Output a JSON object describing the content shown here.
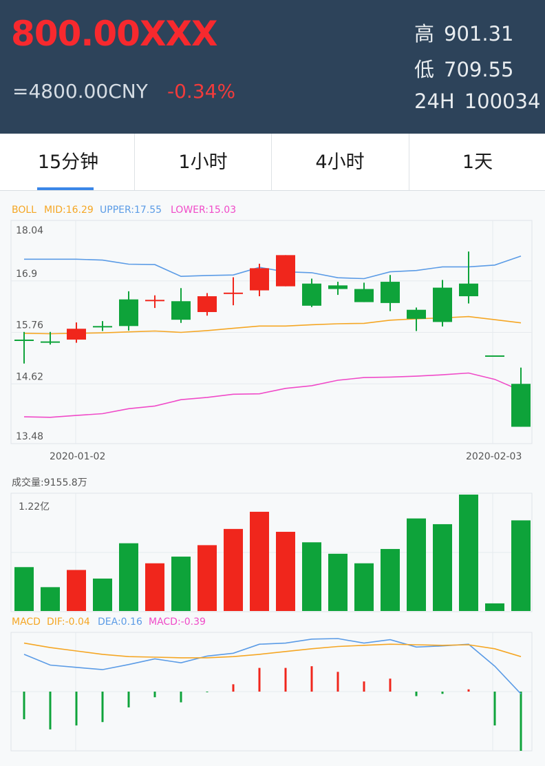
{
  "header": {
    "price": "800.00XXX",
    "cny": "=4800.00CNY",
    "change_pct": "-0.34%",
    "stats": [
      {
        "label": "高",
        "value": "901.31"
      },
      {
        "label": "低",
        "value": "709.55"
      },
      {
        "label": "24H",
        "value": "100034"
      }
    ]
  },
  "tabs": [
    {
      "label": "15分钟",
      "active": true
    },
    {
      "label": "1小时",
      "active": false
    },
    {
      "label": "4小时",
      "active": false
    },
    {
      "label": "1天",
      "active": false
    }
  ],
  "colors": {
    "up": "#f0261c",
    "down": "#0ea33a",
    "mid": "#f5a623",
    "upper": "#5a9be6",
    "lower": "#f04ac8",
    "header_bg": "#2d435a",
    "tab_active": "#3a86e8"
  },
  "boll": {
    "label": "BOLL",
    "mid": "MID:16.29",
    "upper": "UPPER:17.55",
    "lower": "LOWER:15.03"
  },
  "volume": {
    "label": "成交量:9155.8万",
    "axis_top": "1.22亿"
  },
  "macd": {
    "label": "MACD",
    "dif": "DIF:-0.04",
    "dea": "DEA:0.16",
    "macd": "MACD:-0.39"
  },
  "chart_data": [
    {
      "type": "candlestick",
      "y_ticks": [
        "18.04",
        "16.9",
        "15.76",
        "14.62",
        "13.48"
      ],
      "ylim": [
        13.48,
        18.04
      ],
      "x_labels": [
        "2020-01-02",
        "2020-02-03"
      ],
      "candles": [
        {
          "o": 15.6,
          "c": 15.6,
          "h": 15.77,
          "l": 15.07,
          "dir": "down"
        },
        {
          "o": 15.56,
          "c": 15.56,
          "h": 15.77,
          "l": 15.49,
          "dir": "down"
        },
        {
          "o": 15.6,
          "c": 15.84,
          "h": 15.98,
          "l": 15.53,
          "dir": "up"
        },
        {
          "o": 15.9,
          "c": 15.9,
          "h": 16.01,
          "l": 15.79,
          "dir": "down"
        },
        {
          "o": 16.49,
          "c": 15.9,
          "h": 16.67,
          "l": 15.8,
          "dir": "down"
        },
        {
          "o": 16.48,
          "c": 16.48,
          "h": 16.58,
          "l": 16.3,
          "dir": "up"
        },
        {
          "o": 16.45,
          "c": 16.04,
          "h": 16.74,
          "l": 15.97,
          "dir": "down"
        },
        {
          "o": 16.21,
          "c": 16.56,
          "h": 16.63,
          "l": 16.13,
          "dir": "up"
        },
        {
          "o": 16.64,
          "c": 16.64,
          "h": 16.98,
          "l": 16.36,
          "dir": "up"
        },
        {
          "o": 16.69,
          "c": 17.18,
          "h": 17.28,
          "l": 16.56,
          "dir": "up"
        },
        {
          "o": 16.78,
          "c": 17.47,
          "h": 17.47,
          "l": 16.78,
          "dir": "up"
        },
        {
          "o": 16.84,
          "c": 16.35,
          "h": 16.95,
          "l": 16.32,
          "dir": "down"
        },
        {
          "o": 16.8,
          "c": 16.72,
          "h": 16.88,
          "l": 16.59,
          "dir": "down"
        },
        {
          "o": 16.72,
          "c": 16.43,
          "h": 16.86,
          "l": 16.43,
          "dir": "down"
        },
        {
          "o": 16.88,
          "c": 16.41,
          "h": 17.03,
          "l": 16.23,
          "dir": "down"
        },
        {
          "o": 16.26,
          "c": 16.06,
          "h": 16.31,
          "l": 15.79,
          "dir": "down"
        },
        {
          "o": 16.75,
          "c": 15.99,
          "h": 16.92,
          "l": 15.89,
          "dir": "down"
        },
        {
          "o": 16.84,
          "c": 16.56,
          "h": 17.55,
          "l": 16.4,
          "dir": "down"
        },
        {
          "o": 15.25,
          "c": 15.25,
          "h": 15.25,
          "l": 15.25,
          "dir": "down"
        },
        {
          "o": 14.62,
          "c": 13.67,
          "h": 14.98,
          "l": 13.67,
          "dir": "down"
        }
      ],
      "mid_line": [
        15.74,
        15.73,
        15.74,
        15.75,
        15.77,
        15.79,
        15.76,
        15.8,
        15.85,
        15.9,
        15.9,
        15.93,
        15.95,
        15.96,
        16.03,
        16.06,
        16.08,
        16.11,
        16.04,
        15.97
      ],
      "upper_line": [
        17.38,
        17.38,
        17.38,
        17.36,
        17.27,
        17.26,
        17.0,
        17.02,
        17.03,
        17.2,
        17.1,
        17.08,
        16.97,
        16.95,
        17.1,
        17.13,
        17.21,
        17.21,
        17.25,
        17.45
      ],
      "lower_line": [
        13.89,
        13.88,
        13.92,
        13.96,
        14.07,
        14.13,
        14.27,
        14.32,
        14.39,
        14.4,
        14.52,
        14.58,
        14.7,
        14.76,
        14.77,
        14.79,
        14.82,
        14.86,
        14.72,
        14.47
      ]
    },
    {
      "type": "bar",
      "name": "volume",
      "values": [
        0.46,
        0.25,
        0.43,
        0.34,
        0.71,
        0.5,
        0.57,
        0.69,
        0.86,
        1.04,
        0.83,
        0.72,
        0.6,
        0.5,
        0.65,
        0.97,
        0.91,
        1.22,
        0.08,
        0.95
      ],
      "dirs": [
        "down",
        "down",
        "up",
        "down",
        "down",
        "up",
        "down",
        "up",
        "up",
        "up",
        "up",
        "down",
        "down",
        "down",
        "down",
        "down",
        "down",
        "down",
        "down",
        "down"
      ],
      "ylim": [
        0,
        1.22
      ]
    },
    {
      "type": "line",
      "name": "macd",
      "dif": [
        0.66,
        0.47,
        0.43,
        0.39,
        0.48,
        0.58,
        0.51,
        0.63,
        0.68,
        0.84,
        0.86,
        0.93,
        0.94,
        0.86,
        0.92,
        0.79,
        0.81,
        0.84,
        0.45,
        -0.04
      ],
      "dea": [
        0.86,
        0.78,
        0.72,
        0.66,
        0.62,
        0.61,
        0.6,
        0.6,
        0.62,
        0.66,
        0.71,
        0.76,
        0.8,
        0.82,
        0.84,
        0.83,
        0.82,
        0.83,
        0.76,
        0.62
      ],
      "hist": [
        -0.49,
        -0.67,
        -0.6,
        -0.54,
        -0.28,
        -0.1,
        -0.19,
        -0.01,
        0.13,
        0.42,
        0.42,
        0.45,
        0.35,
        0.18,
        0.23,
        -0.08,
        -0.04,
        0.04,
        -0.6,
        -1.05
      ],
      "ylim": [
        -1.05,
        1.05
      ]
    }
  ]
}
